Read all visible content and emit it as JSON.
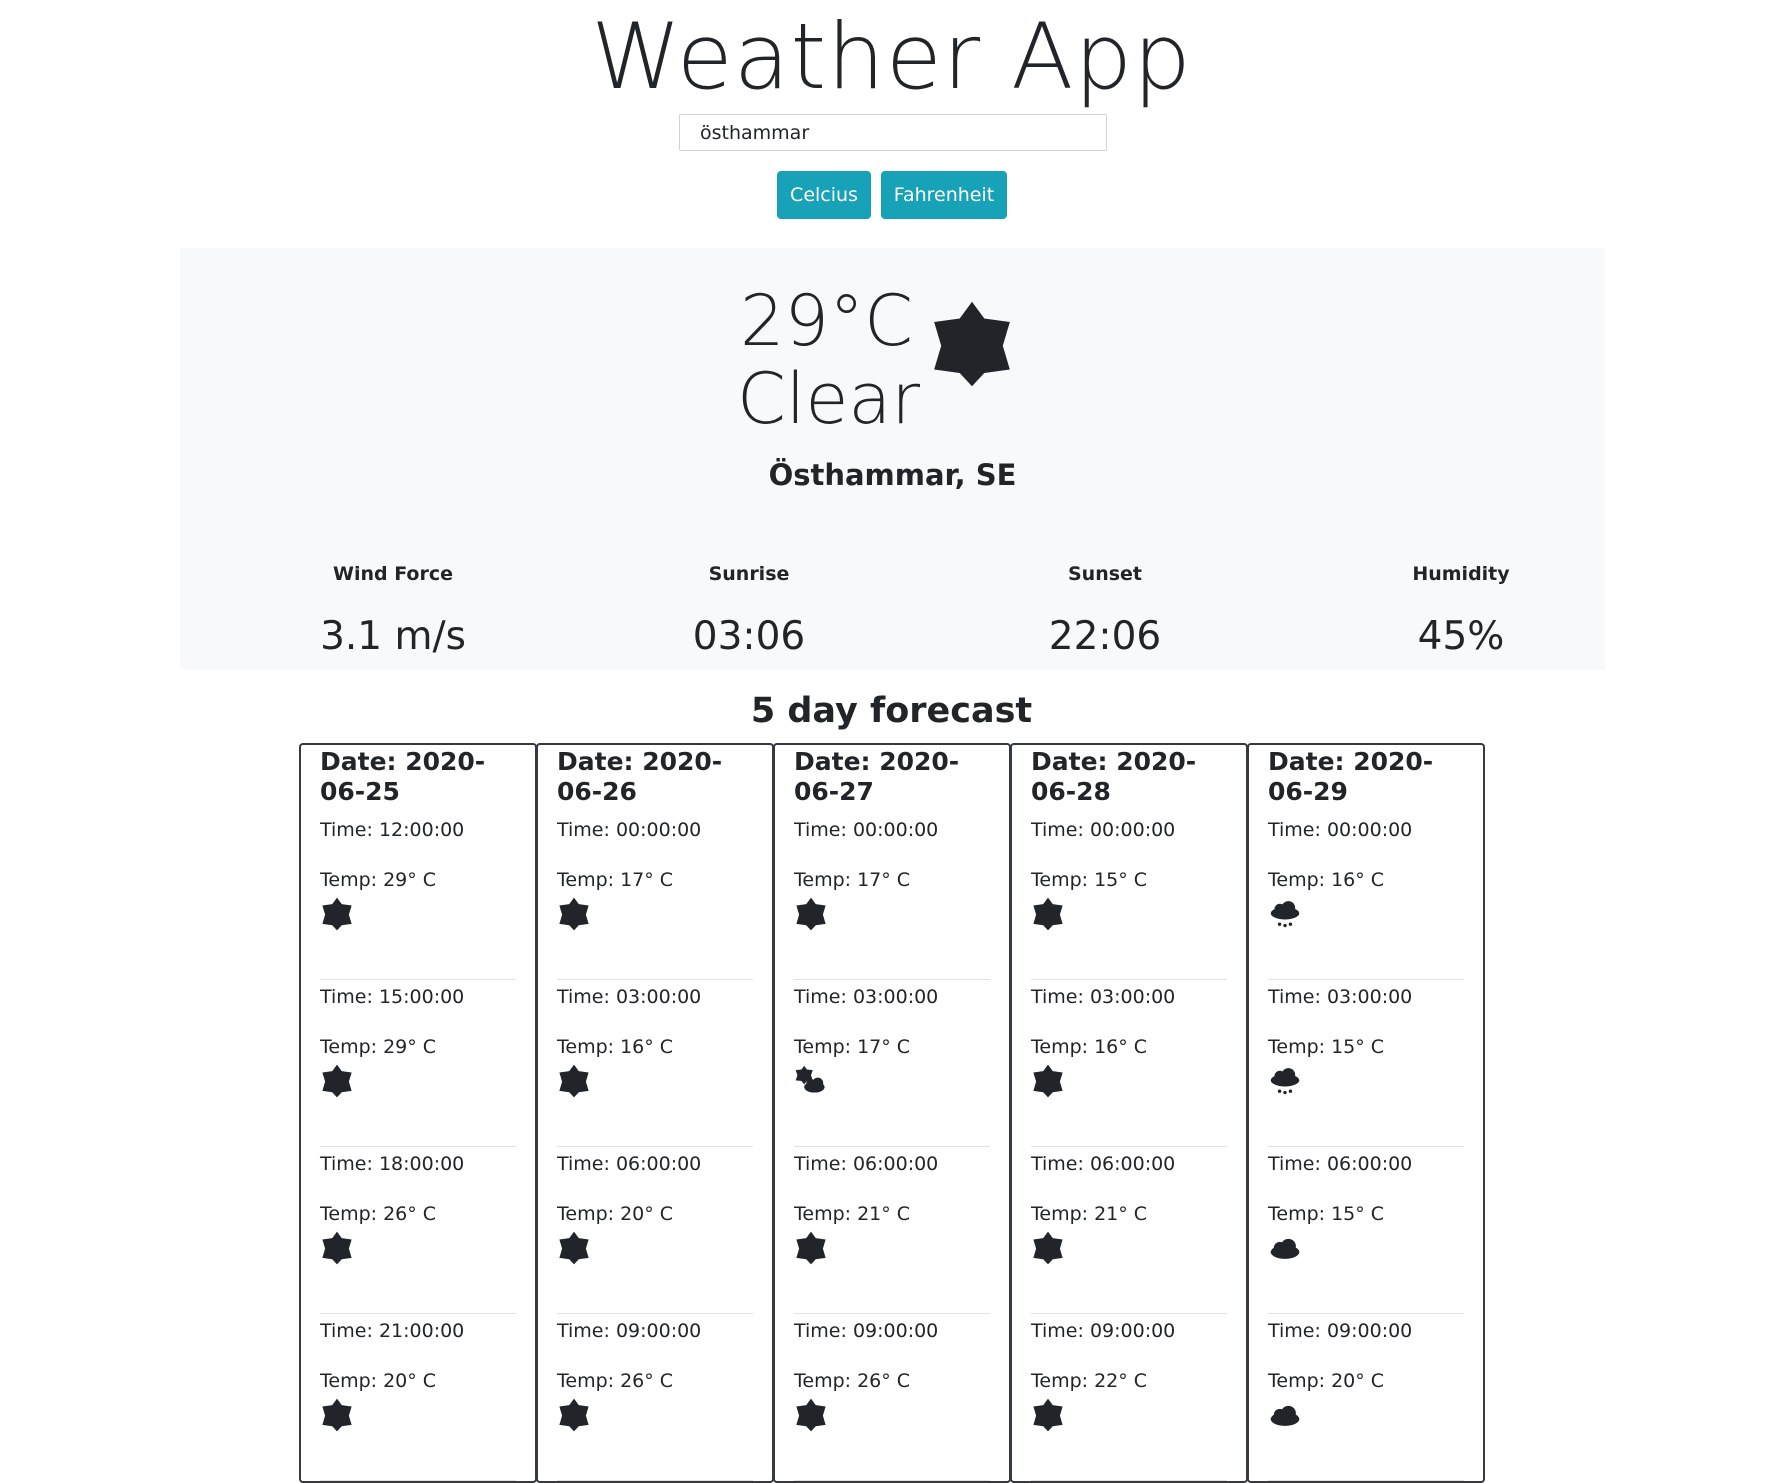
{
  "app": {
    "title": "Weather App"
  },
  "search": {
    "value": "östhammar"
  },
  "units": {
    "celsius_label": "Celcius",
    "fahrenheit_label": "Fahrenheit"
  },
  "current": {
    "temperature": "29°C",
    "condition": "Clear",
    "location": "Östhammar, SE",
    "icon": "sun-icon",
    "stats": [
      {
        "label": "Wind Force",
        "value": "3.1 m/s"
      },
      {
        "label": "Sunrise",
        "value": "03:06"
      },
      {
        "label": "Sunset",
        "value": "22:06"
      },
      {
        "label": "Humidity",
        "value": "45%"
      }
    ]
  },
  "forecast": {
    "title": "5 day forecast",
    "days": [
      {
        "date": "Date: 2020-06-25",
        "slots": [
          {
            "time": "Time: 12:00:00",
            "temp": "Temp: 29° C",
            "icon": "sun-icon"
          },
          {
            "time": "Time: 15:00:00",
            "temp": "Temp: 29° C",
            "icon": "sun-icon"
          },
          {
            "time": "Time: 18:00:00",
            "temp": "Temp: 26° C",
            "icon": "sun-icon"
          },
          {
            "time": "Time: 21:00:00",
            "temp": "Temp: 20° C",
            "icon": "sun-icon"
          }
        ]
      },
      {
        "date": "Date: 2020-06-26",
        "slots": [
          {
            "time": "Time: 00:00:00",
            "temp": "Temp: 17° C",
            "icon": "sun-icon"
          },
          {
            "time": "Time: 03:00:00",
            "temp": "Temp: 16° C",
            "icon": "sun-icon"
          },
          {
            "time": "Time: 06:00:00",
            "temp": "Temp: 20° C",
            "icon": "sun-icon"
          },
          {
            "time": "Time: 09:00:00",
            "temp": "Temp: 26° C",
            "icon": "sun-icon"
          }
        ]
      },
      {
        "date": "Date: 2020-06-27",
        "slots": [
          {
            "time": "Time: 00:00:00",
            "temp": "Temp: 17° C",
            "icon": "sun-icon"
          },
          {
            "time": "Time: 03:00:00",
            "temp": "Temp: 17° C",
            "icon": "partly-cloudy-icon"
          },
          {
            "time": "Time: 06:00:00",
            "temp": "Temp: 21° C",
            "icon": "sun-icon"
          },
          {
            "time": "Time: 09:00:00",
            "temp": "Temp: 26° C",
            "icon": "sun-icon"
          }
        ]
      },
      {
        "date": "Date: 2020-06-28",
        "slots": [
          {
            "time": "Time: 00:00:00",
            "temp": "Temp: 15° C",
            "icon": "sun-icon"
          },
          {
            "time": "Time: 03:00:00",
            "temp": "Temp: 16° C",
            "icon": "sun-icon"
          },
          {
            "time": "Time: 06:00:00",
            "temp": "Temp: 21° C",
            "icon": "sun-icon"
          },
          {
            "time": "Time: 09:00:00",
            "temp": "Temp: 22° C",
            "icon": "sun-icon"
          }
        ]
      },
      {
        "date": "Date: 2020-06-29",
        "slots": [
          {
            "time": "Time: 00:00:00",
            "temp": "Temp: 16° C",
            "icon": "rain-cloud-icon"
          },
          {
            "time": "Time: 03:00:00",
            "temp": "Temp: 15° C",
            "icon": "rain-cloud-icon"
          },
          {
            "time": "Time: 06:00:00",
            "temp": "Temp: 15° C",
            "icon": "cloud-icon"
          },
          {
            "time": "Time: 09:00:00",
            "temp": "Temp: 20° C",
            "icon": "cloud-icon"
          }
        ]
      }
    ]
  },
  "colors": {
    "accent": "#17a2b8",
    "panel": "#f8f9fa",
    "text": "#212529"
  }
}
